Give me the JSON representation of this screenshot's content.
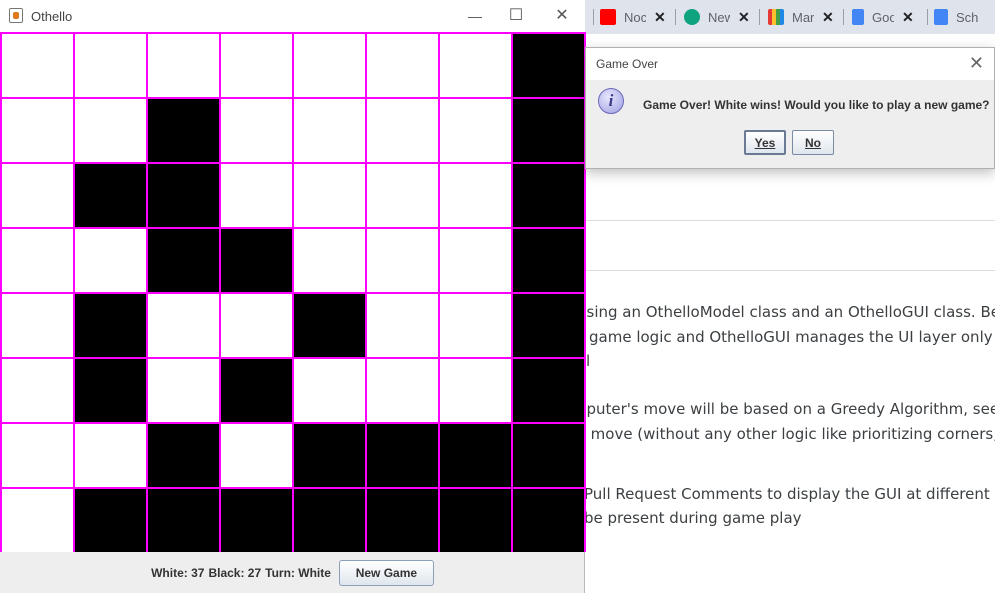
{
  "othello": {
    "title": "Othello",
    "minimize_glyph": "—",
    "maximize_glyph": "☐",
    "close_glyph": "✕",
    "board": [
      [
        "w",
        "w",
        "w",
        "w",
        "w",
        "w",
        "w",
        "b"
      ],
      [
        "w",
        "w",
        "b",
        "w",
        "w",
        "w",
        "w",
        "b"
      ],
      [
        "w",
        "b",
        "b",
        "w",
        "w",
        "w",
        "w",
        "b"
      ],
      [
        "w",
        "w",
        "b",
        "b",
        "w",
        "w",
        "w",
        "b"
      ],
      [
        "w",
        "b",
        "w",
        "w",
        "b",
        "w",
        "w",
        "b"
      ],
      [
        "w",
        "b",
        "w",
        "b",
        "w",
        "w",
        "w",
        "b"
      ],
      [
        "w",
        "w",
        "b",
        "w",
        "b",
        "b",
        "b",
        "b"
      ],
      [
        "w",
        "b",
        "b",
        "b",
        "b",
        "b",
        "b",
        "b"
      ]
    ],
    "status": {
      "white": "White: 37",
      "black": "Black: 27",
      "turn": "Turn: White"
    },
    "new_game_label": "New Game",
    "grid_color": "#ff00ff"
  },
  "dialog": {
    "title": "Game Over",
    "close_glyph": "✕",
    "icon": "info-icon",
    "icon_glyph": "i",
    "message": "Game Over! White wins! Would you like to play a new game?",
    "yes_label": "Yes",
    "no_label": "No"
  },
  "browser": {
    "tabs": [
      {
        "label": "Noc",
        "icon": "youtube-icon",
        "color": "#ff0000"
      },
      {
        "label": "New",
        "icon": "openai-icon",
        "color": "#10a37f"
      },
      {
        "label": "Mar",
        "icon": "bag-icon",
        "color": "#7b3f00"
      },
      {
        "label": "Goo",
        "icon": "google-docs-icon",
        "color": "#4285f4"
      },
      {
        "label": "Sch",
        "icon": "docs-icon",
        "color": "#4285f4"
      }
    ],
    "doc_lines": [
      "using an OthelloModel class and an OthelloGUI class. Be su",
      "game logic and OthelloGUI manages the UI layer only and",
      "l",
      "nputer's move will be based on a Greedy Algorithm, seeking",
      "t move (without any other logic like prioritizing corners, side",
      "Pull Request Comments to display the GUI at different stag",
      "be present during game play"
    ]
  }
}
